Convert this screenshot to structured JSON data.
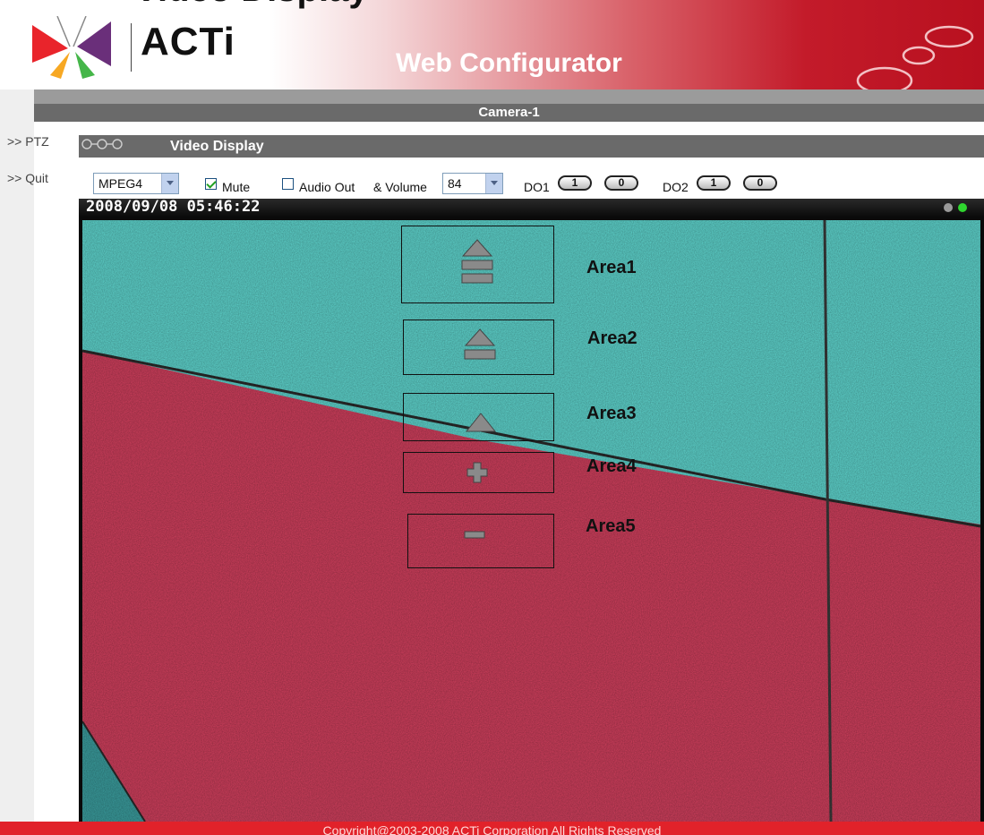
{
  "page": {
    "cut_title": "Video Display"
  },
  "header": {
    "logo_text": "ACTi",
    "title": "Web Configurator",
    "logo_icon": "acti-butterfly-logo",
    "accent": "#c31b2a"
  },
  "camera_bar": {
    "title": "Camera-1"
  },
  "nav": {
    "items": [
      {
        "label": ">> PTZ"
      },
      {
        "label": ">> Quit"
      }
    ]
  },
  "video_display": {
    "title": "Video Display"
  },
  "controls": {
    "codec": {
      "value": "MPEG4"
    },
    "mute": {
      "label": "Mute",
      "checked": true
    },
    "audio_out": {
      "label": "Audio Out",
      "checked": false
    },
    "volume": {
      "label": "& Volume",
      "value": "84"
    },
    "do1": {
      "label": "DO1",
      "on_label": "1",
      "off_label": "0"
    },
    "do2": {
      "label": "DO2",
      "on_label": "1",
      "off_label": "0"
    }
  },
  "video": {
    "timestamp": "2008/09/08 05:46:22",
    "areas": [
      {
        "label": "Area1",
        "icon": "triangle-double-bar-icon"
      },
      {
        "label": "Area2",
        "icon": "triangle-bar-icon"
      },
      {
        "label": "Area3",
        "icon": "triangle-icon"
      },
      {
        "label": "Area4",
        "icon": "plus-icon"
      },
      {
        "label": "Area5",
        "icon": "minus-icon"
      }
    ],
    "colors": {
      "wall_top": "#5fd6cf",
      "wall_bottom": "#d2405e",
      "seam": "#2a2a2a"
    }
  },
  "footer": {
    "copyright": "Copyright@2003-2008 ACTi Corporation All Rights Reserved"
  }
}
